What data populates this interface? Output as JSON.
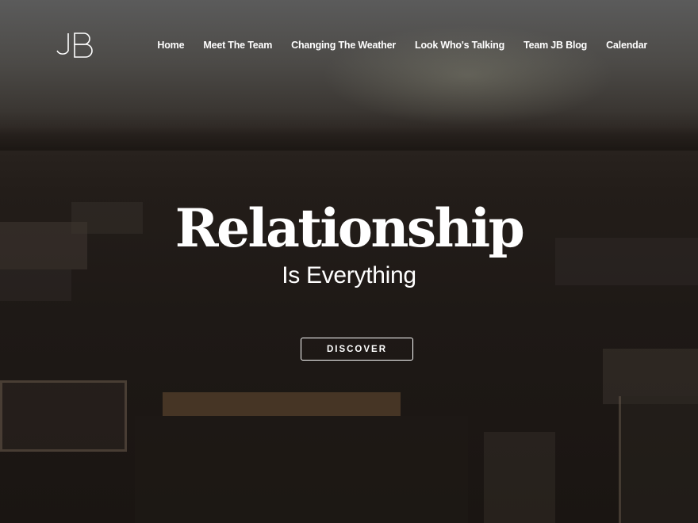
{
  "logo": {
    "text": "JB"
  },
  "nav": {
    "items": [
      {
        "label": "Home"
      },
      {
        "label": "Meet The Team"
      },
      {
        "label": "Changing The Weather"
      },
      {
        "label": "Look Who's Talking"
      },
      {
        "label": "Team JB Blog"
      },
      {
        "label": "Calendar"
      }
    ]
  },
  "hero": {
    "headline": "Relationship",
    "subheadline": "Is Everything",
    "cta_label": "DISCOVER"
  },
  "colors": {
    "text": "#ffffff",
    "overlay": "#1b1714"
  }
}
